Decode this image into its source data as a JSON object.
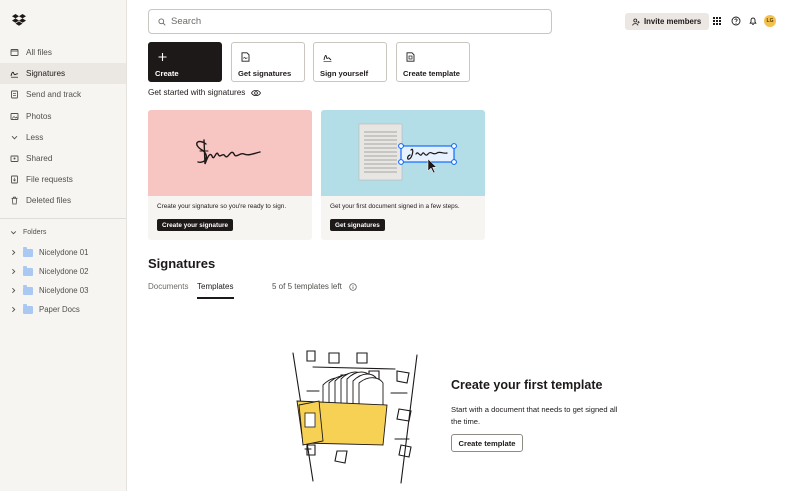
{
  "sidebar": {
    "logo": "dropbox-logo",
    "items": [
      {
        "label": "All files",
        "icon": "files-icon"
      },
      {
        "label": "Signatures",
        "icon": "signature-icon",
        "active": true
      },
      {
        "label": "Send and track",
        "icon": "send-icon"
      },
      {
        "label": "Photos",
        "icon": "photo-icon"
      },
      {
        "label": "Less",
        "icon": "chevron-down-icon"
      },
      {
        "label": "Shared",
        "icon": "shared-icon"
      },
      {
        "label": "File requests",
        "icon": "file-request-icon"
      },
      {
        "label": "Deleted files",
        "icon": "trash-icon"
      }
    ],
    "folders_label": "Folders",
    "folders": [
      {
        "label": "Nicelydone 01"
      },
      {
        "label": "Nicelydone 02"
      },
      {
        "label": "Nicelydone 03"
      },
      {
        "label": "Paper Docs"
      }
    ]
  },
  "header": {
    "search_placeholder": "Search",
    "invite_label": "Invite members",
    "avatar_initials": "LG"
  },
  "actions": [
    {
      "label": "Create",
      "icon": "plus-icon"
    },
    {
      "label": "Get signatures",
      "icon": "document-sign-icon"
    },
    {
      "label": "Sign yourself",
      "icon": "pen-icon"
    },
    {
      "label": "Create template",
      "icon": "template-icon"
    }
  ],
  "get_started": {
    "label": "Get started with signatures",
    "cards": [
      {
        "description": "Create your signature so you're ready to sign.",
        "button": "Create your signature",
        "bg": "#f7c5c2"
      },
      {
        "description": "Get your first document signed in a few steps.",
        "button": "Get signatures",
        "bg": "#b3dde7"
      }
    ]
  },
  "signatures": {
    "title": "Signatures",
    "tabs": [
      {
        "label": "Documents",
        "active": false
      },
      {
        "label": "Templates",
        "active": true
      }
    ],
    "quota": "5 of 5 templates left"
  },
  "empty_state": {
    "title": "Create your first template",
    "description": "Start with a document that needs to get signed all the time.",
    "button": "Create template"
  },
  "colors": {
    "accent_dark": "#1e1919",
    "folder_blue": "#a9c9f2",
    "cabinet_yellow": "#f7d154",
    "selection_blue": "#0061fe"
  }
}
